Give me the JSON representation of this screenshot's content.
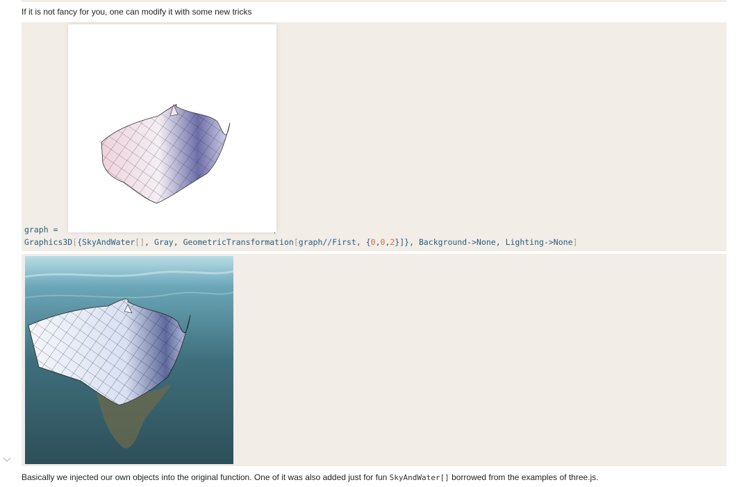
{
  "intro_text": "If it is not fancy for you, one can modify it with some new tricks",
  "input_cell": {
    "line1_var": "graph",
    "line1_eq": " = ",
    "line1_end": ";",
    "line2": {
      "fn": "Graphics3D",
      "open": "[",
      "brace_open": "{",
      "sky": "SkyAndWater",
      "sky_args": "[]",
      "sep1": ", ",
      "gray": "Gray",
      "sep2": ", ",
      "geo": "GeometricTransformation",
      "geo_open": "[",
      "geo_arg": "graph//First, {",
      "n1": "0",
      "c1": ",",
      "n2": "0",
      "c2": ",",
      "n3": "2",
      "geo_close": "}]}",
      "tail": ", Background->None, Lighting->None",
      "close": "]"
    }
  },
  "footer": {
    "before": "Basically we injected our own objects into the original function. One of it was also added just for fun ",
    "code": "SkyAndWater[]",
    "after": " borrowed from the examples of three.js."
  },
  "icons": {
    "collapse": "chevron-down-icon"
  },
  "colors": {
    "cell_bg": "#f2ede7",
    "code_blue": "#275f7c",
    "number_red": "#d7674a"
  }
}
